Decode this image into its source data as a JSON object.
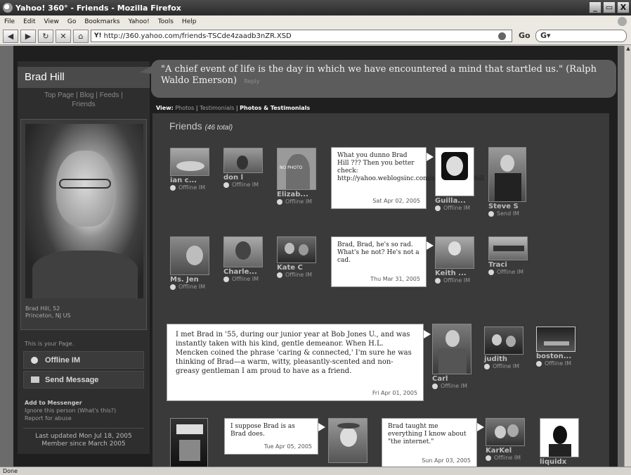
{
  "window": {
    "title": "Yahoo! 360° - Friends - Mozilla Firefox",
    "buttons": [
      "_",
      "▭",
      "X"
    ]
  },
  "menu": [
    "File",
    "Edit",
    "View",
    "Go",
    "Bookmarks",
    "Yahoo!",
    "Tools",
    "Help"
  ],
  "nav": {
    "url": "http://360.yahoo.com/friends-TSCde4zaadb3nZR.XSD",
    "go_label": "Go",
    "search_value": "G▾"
  },
  "status_text": "Done",
  "profile": {
    "name": "Brad Hill",
    "nav_links": [
      "Top Page",
      "Blog",
      "Feeds",
      "Friends"
    ],
    "caption_line1": "Brad Hill, 52",
    "caption_line2": "Princeton, NJ US",
    "your_page": "This is your Page.",
    "offline_label": "Offline IM",
    "send_label": "Send Message",
    "add_messenger": "Add to Messenger",
    "ignore": "Ignore this person (What's this?)",
    "report": "Report for abuse",
    "last_updated": "Last updated Mon Jul 18, 2005",
    "member_since": "Member since March 2005"
  },
  "quote": {
    "text": "\"A chief event of life is the day in which we have encountered a mind that startled us.\" (Ralph Waldo Emerson)",
    "reply": "Reply"
  },
  "view": {
    "label": "View:",
    "photos": "Photos",
    "testimonials": "Testimonials",
    "both": "Photos & Testimonials"
  },
  "friends": {
    "heading": "Friends",
    "count": "(46 total)",
    "people": [
      {
        "name": "ian c...",
        "status": "Offline IM"
      },
      {
        "name": "don l",
        "status": "Offline IM"
      },
      {
        "name": "Elizab...",
        "status": "Offline IM",
        "no_photo": "NO PHOTO"
      },
      {
        "name": "Guilla...",
        "status": "Offline IM"
      },
      {
        "name": "Steve S",
        "status": "Send IM"
      },
      {
        "name": "Ms. Jen",
        "status": "Offline IM"
      },
      {
        "name": "Charle...",
        "status": "Offline IM"
      },
      {
        "name": "Kate C",
        "status": "Offline IM"
      },
      {
        "name": "Keith ...",
        "status": "Offline IM"
      },
      {
        "name": "Traci",
        "status": "Offline IM"
      },
      {
        "name": "Carl",
        "status": "Offline IM"
      },
      {
        "name": "judith",
        "status": "Offline IM"
      },
      {
        "name": "boston...",
        "status": "Offline IM"
      },
      {
        "name": "KarKel",
        "status": "Offline IM"
      },
      {
        "name": "liquidx",
        "status": ""
      }
    ],
    "testimonials": [
      {
        "text": "What you dunno Brad Hill ??? Then you better check: http://yahoo.weblogsinc.com/about/#brad.hill",
        "date": "Sat Apr 02, 2005"
      },
      {
        "text": "Brad, Brad, he's so rad. What's he not? He's not a cad.",
        "date": "Thu Mar 31, 2005"
      },
      {
        "text": "I met Brad in '55, during our junior year at Bob Jones U., and was instantly taken with his kind, gentle demeanor. When H.L. Mencken coined the phrase 'caring & connected,' I'm sure he was thinking of Brad—a warm, witty, pleasantly-scented and non-greasy gentleman I am proud to have as a friend.",
        "date": "Fri Apr 01, 2005"
      },
      {
        "text": "I suppose Brad is as Brad does.",
        "date": "Tue Apr 05, 2005"
      },
      {
        "text": "Brad taught me everything I know about \"the internet.\"",
        "date": "Sun Apr 03, 2005"
      }
    ]
  }
}
